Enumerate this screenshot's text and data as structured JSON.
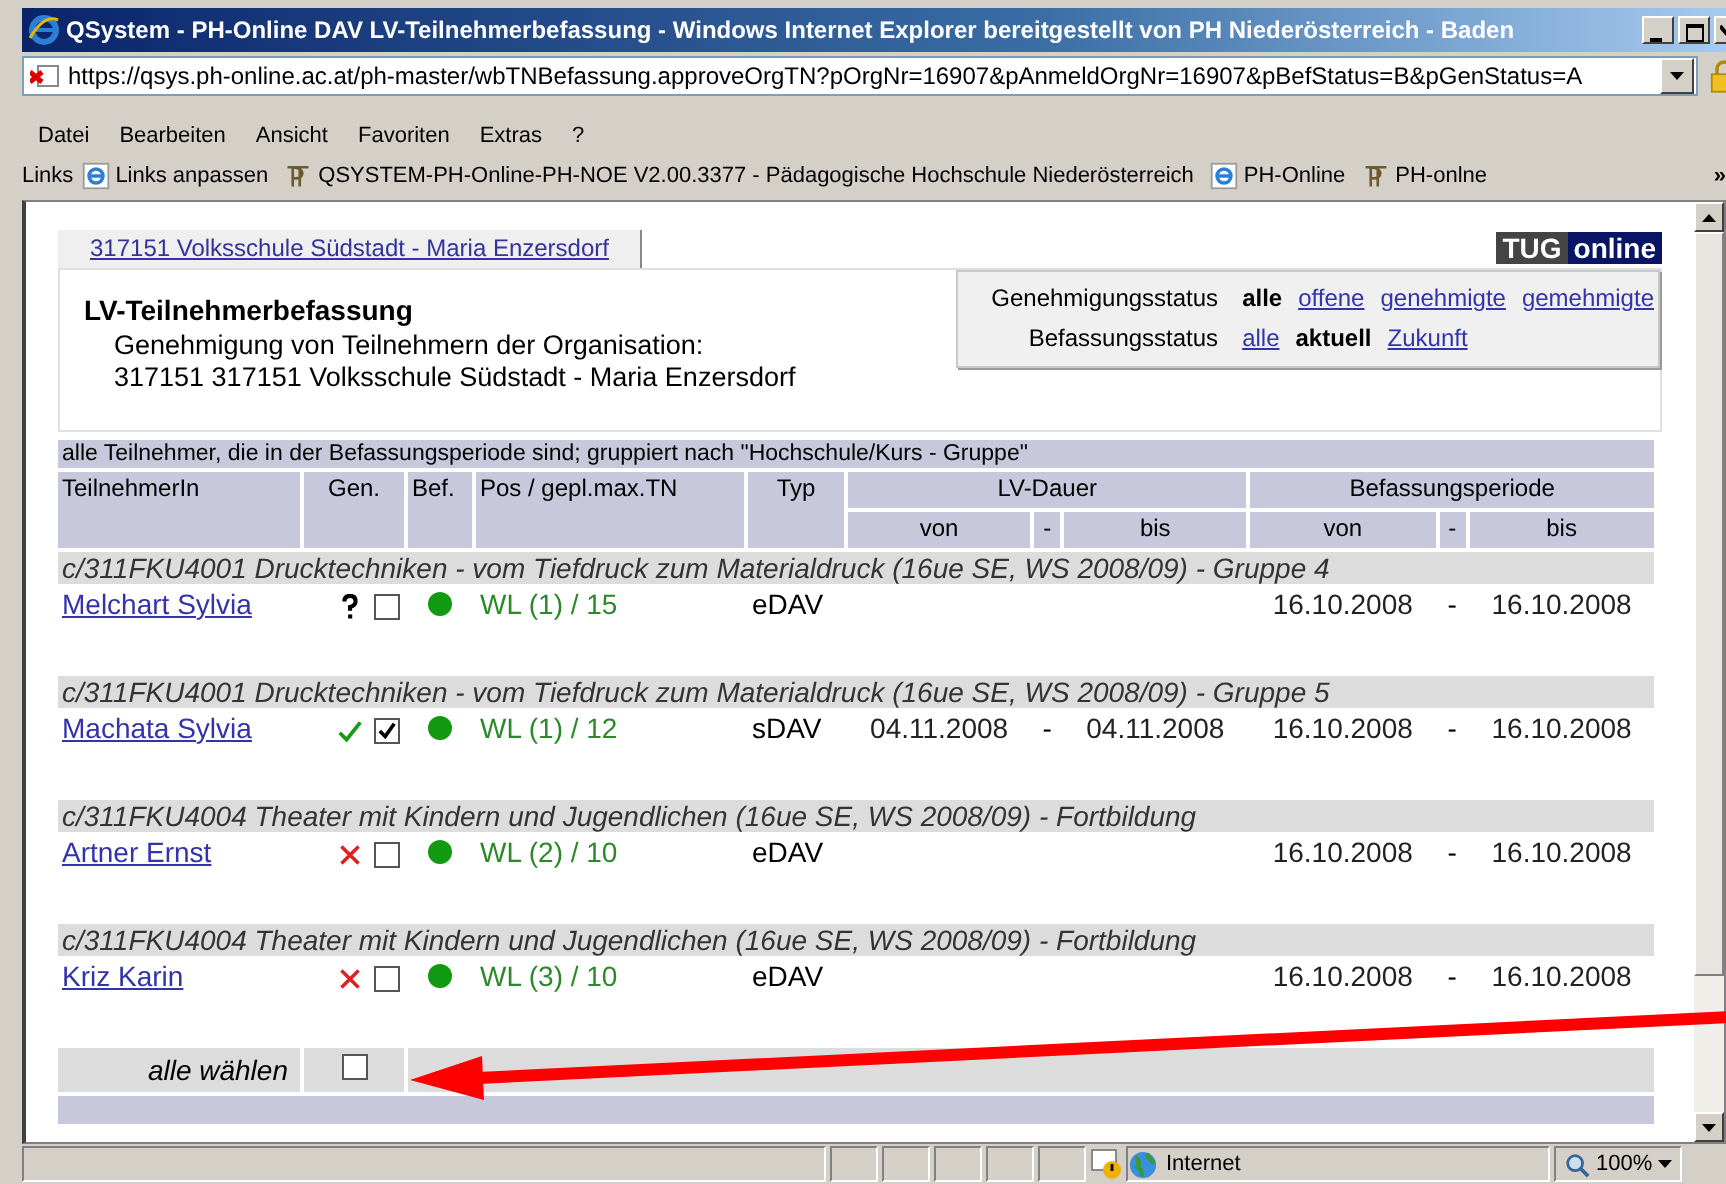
{
  "window": {
    "title": "QSystem - PH-Online DAV LV-Teilnehmerbefassung - Windows Internet Explorer bereitgestellt von PH Niederösterreich - Baden"
  },
  "address_bar": {
    "url": "https://qsys.ph-online.ac.at/ph-master/wbTNBefassung.approveOrgTN?pOrgNr=16907&pAnmeldOrgNr=16907&pBefStatus=B&pGenStatus=A"
  },
  "menu": [
    "Datei",
    "Bearbeiten",
    "Ansicht",
    "Favoriten",
    "Extras",
    "?"
  ],
  "links_bar": {
    "label": "Links",
    "more": "»",
    "items": [
      {
        "kind": "ie",
        "label": "Links anpassen"
      },
      {
        "kind": "ph",
        "label": "QSYSTEM-PH-Online-PH-NOE V2.00.3377 - Pädagogische Hochschule Niederösterreich"
      },
      {
        "kind": "ie",
        "label": "PH-Online"
      },
      {
        "kind": "ph",
        "label": "PH-onlne"
      }
    ]
  },
  "page": {
    "org_tab": "317151 Volksschule Südstadt - Maria Enzersdorf",
    "logo": {
      "left": "TUG",
      "right": "online"
    },
    "heading": "LV-Teilnehmerbefassung",
    "subtitle": [
      "Genehmigung von Teilnehmern der Organisation:",
      "317151 317151 Volksschule Südstadt - Maria Enzersdorf"
    ],
    "filters": [
      {
        "label": "Genehmigungsstatus",
        "options": [
          {
            "label": "alle",
            "selected": true
          },
          {
            "label": "offene",
            "selected": false
          },
          {
            "label": "genehmigte",
            "selected": false
          },
          {
            "label": "gemehmigte",
            "selected": false
          }
        ]
      },
      {
        "label": "Befassungsstatus",
        "options": [
          {
            "label": "alle",
            "selected": false
          },
          {
            "label": "aktuell",
            "selected": true
          },
          {
            "label": "Zukunft",
            "selected": false
          }
        ]
      }
    ]
  },
  "table": {
    "caption": "alle Teilnehmer, die in der Befassungsperiode sind; gruppiert nach \"Hochschule/Kurs - Gruppe\"",
    "columns": [
      "TeilnehmerIn",
      "Gen.",
      "Bef.",
      "Pos / gepl.max.TN",
      "Typ"
    ],
    "column_groups": [
      {
        "label": "LV-Dauer",
        "sub": [
          "von",
          "-",
          "bis"
        ]
      },
      {
        "label": "Befassungsperiode",
        "sub": [
          "von",
          "-",
          "bis"
        ]
      }
    ],
    "groups": [
      {
        "title": "c/311FKU4001 Drucktechniken - vom Tiefdruck zum Materialdruck (16ue SE, WS 2008/09) - Gruppe 4",
        "rows": [
          {
            "name": "Melchart Sylvia",
            "approval": {
              "kind": "open"
            },
            "checked": false,
            "pos": "WL (1) / 15",
            "typ": "eDAV",
            "bef_von": "16.10.2008",
            "bef_dash": "-",
            "bef_bis": "16.10.2008"
          }
        ]
      },
      {
        "title": "c/311FKU4001 Drucktechniken - vom Tiefdruck zum Materialdruck (16ue SE, WS 2008/09) - Gruppe 5",
        "rows": [
          {
            "name": "Machata Sylvia",
            "approval": {
              "kind": "approved"
            },
            "checked": true,
            "pos": "WL (1) / 12",
            "typ": "sDAV",
            "lv_von": "04.11.2008",
            "lv_dash": "-",
            "lv_bis": "04.11.2008",
            "bef_von": "16.10.2008",
            "bef_dash": "-",
            "bef_bis": "16.10.2008"
          }
        ]
      },
      {
        "title": "c/311FKU4004 Theater mit Kindern und Jugendlichen (16ue SE, WS 2008/09) - Fortbildung",
        "rows": [
          {
            "name": "Artner Ernst",
            "approval": {
              "kind": "rejected"
            },
            "checked": false,
            "pos": "WL (2) / 10",
            "typ": "eDAV",
            "bef_von": "16.10.2008",
            "bef_dash": "-",
            "bef_bis": "16.10.2008"
          }
        ]
      },
      {
        "title": "c/311FKU4004 Theater mit Kindern und Jugendlichen (16ue SE, WS 2008/09) - Fortbildung",
        "rows": [
          {
            "name": "Kriz Karin",
            "approval": {
              "kind": "rejected"
            },
            "checked": false,
            "pos": "WL (3) / 10",
            "typ": "eDAV",
            "bef_von": "16.10.2008",
            "bef_dash": "-",
            "bef_bis": "16.10.2008"
          }
        ]
      }
    ],
    "select_all": {
      "label": "alle wählen",
      "checked": false
    }
  },
  "status_bar": {
    "zone": "Internet",
    "zoom": "100%"
  }
}
